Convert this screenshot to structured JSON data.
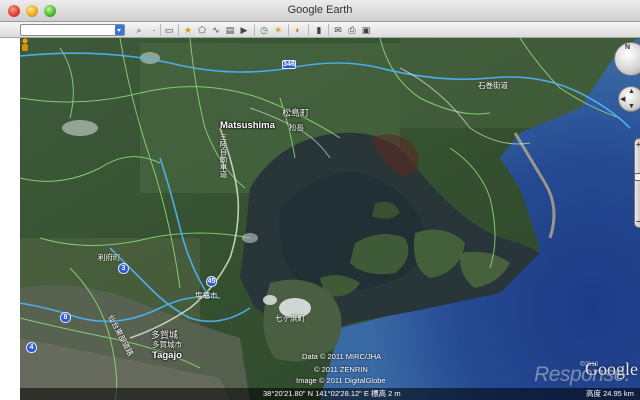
{
  "window": {
    "title": "Google Earth"
  },
  "toolbar": {
    "search_placeholder": "",
    "buttons": [
      {
        "name": "search-icon",
        "glyph": "🔍"
      },
      {
        "name": "dot-icon",
        "glyph": "·"
      },
      {
        "name": "sidebar-icon",
        "glyph": "▭"
      },
      {
        "name": "placemark-icon",
        "glyph": "★"
      },
      {
        "name": "polygon-icon",
        "glyph": "⬠"
      },
      {
        "name": "path-icon",
        "glyph": "∿"
      },
      {
        "name": "overlay-icon",
        "glyph": "▤"
      },
      {
        "name": "tour-icon",
        "glyph": "▶"
      },
      {
        "name": "history-icon",
        "glyph": "◷"
      },
      {
        "name": "sun-icon",
        "glyph": "☀"
      },
      {
        "name": "planet-icon",
        "glyph": "◐"
      },
      {
        "name": "ruler-icon",
        "glyph": "▬"
      },
      {
        "name": "email-icon",
        "glyph": "✉"
      },
      {
        "name": "print-icon",
        "glyph": "⎙"
      },
      {
        "name": "maps-icon",
        "glyph": "▣"
      }
    ]
  },
  "map": {
    "labels": {
      "matsushima_en": "Matsushima",
      "matsushima_jp": "松島町",
      "matsushima_jp2": "松島",
      "tagajo_en": "Tagajo",
      "tagajo_jp": "多賀城",
      "tagajo_city": "多賀城市",
      "ishimaki_road": "石巻街道",
      "expressway": "三陸自動車道",
      "rifu": "利府町",
      "shiogama": "塩竈市",
      "shichigahama": "七ヶ浜町",
      "sendai": "仙台東部道路"
    },
    "shields": {
      "r346": "346",
      "r3": "3",
      "r8": "8",
      "r45": "45",
      "r4": "4"
    },
    "attribution": {
      "line1": "Data © 2011 MIRC/JHA",
      "line2": "© 2011 ZENRIN",
      "line3": "Image © 2011 DigitalGlobe",
      "year_small": "©2010"
    },
    "status": {
      "coordinates": "38°20'21.80\" N 141°02'28.12\" E 標高   2 m",
      "altitude": "高度    24.95 km"
    },
    "google_logo": "Google",
    "watermark": "Response.",
    "nav": {
      "north": "N",
      "plus": "+",
      "minus": "−"
    }
  }
}
